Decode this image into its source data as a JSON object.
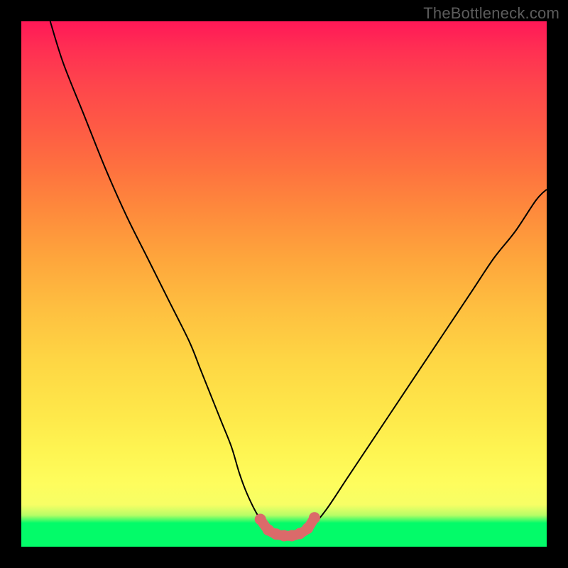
{
  "watermark": "TheBottleneck.com",
  "colors": {
    "frame": "#000000",
    "curve": "#000000",
    "highlight": "#db6a6a",
    "watermark_text": "#5c5c5c"
  },
  "chart_data": {
    "type": "line",
    "title": "",
    "xlabel": "",
    "ylabel": "",
    "xlim": [
      0,
      100
    ],
    "ylim": [
      0,
      100
    ],
    "grid": false,
    "background": "rainbow-gradient (green bottom to red top)",
    "series": [
      {
        "name": "bottleneck-curve",
        "x": [
          5.5,
          8,
          12,
          16,
          20,
          24,
          28,
          32,
          34,
          36,
          38,
          40,
          41.5,
          43,
          45,
          47,
          49,
          51,
          53,
          55,
          58,
          62,
          66,
          70,
          74,
          78,
          82,
          86,
          90,
          94,
          98,
          100
        ],
        "y": [
          100,
          92,
          82,
          72,
          63,
          55,
          47,
          39,
          34,
          29,
          24,
          19,
          14,
          10,
          6,
          3.5,
          2.3,
          2,
          2.3,
          3.5,
          7,
          13,
          19,
          25,
          31,
          37,
          43,
          49,
          55,
          60,
          66,
          68
        ]
      }
    ],
    "highlight_region": {
      "description": "low-bottleneck flat valley marked with salmon band and dots",
      "x_range": [
        45,
        56
      ],
      "y_approx": 2.2,
      "points_x": [
        45.5,
        47,
        48.5,
        50,
        51.5,
        53,
        54.5,
        55.8
      ],
      "points_y": [
        5.2,
        3.2,
        2.4,
        2.1,
        2.1,
        2.5,
        3.5,
        5.5
      ]
    }
  }
}
